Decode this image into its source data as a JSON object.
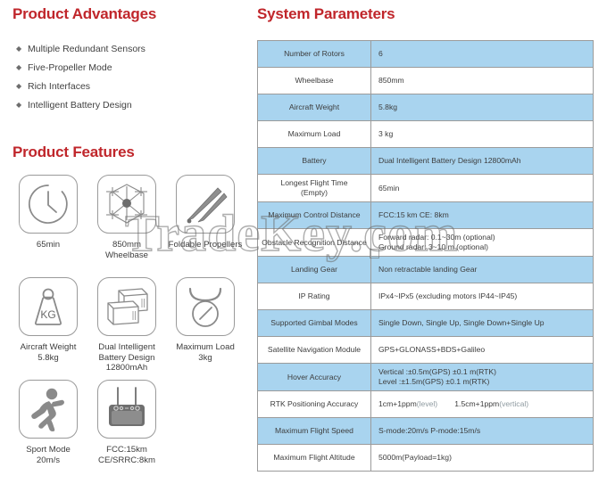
{
  "advantages": {
    "heading": "Product Advantages",
    "bullet_glyph": "◆",
    "items": [
      "Multiple Redundant Sensors",
      "Five-Propeller Mode",
      "Rich Interfaces",
      "Intelligent Battery Design"
    ]
  },
  "features": {
    "heading": "Product Features",
    "items": [
      {
        "icon": "clock-icon",
        "label": "65min"
      },
      {
        "icon": "drone-topview-icon",
        "label": "850mm\nWheelbase"
      },
      {
        "icon": "foldable-propeller-icon",
        "label": "Foldable Propellers"
      },
      {
        "icon": "weight-kg-icon",
        "label": "Aircraft Weight\n5.8kg"
      },
      {
        "icon": "battery-pack-icon",
        "label": "Dual Intelligent\nBattery Design\n12800mAh"
      },
      {
        "icon": "payload-hook-icon",
        "label": "Maximum Load\n3kg"
      },
      {
        "icon": "running-man-icon",
        "label": "Sport Mode\n20m/s"
      },
      {
        "icon": "remote-controller-icon",
        "label": "FCC:15km\nCE/SRRC:8km"
      }
    ]
  },
  "parameters": {
    "heading": "System Parameters",
    "rows": [
      {
        "key": "Number of Rotors",
        "value": "6",
        "shaded": true
      },
      {
        "key": "Wheelbase",
        "value": "850mm",
        "shaded": false
      },
      {
        "key": "Aircraft Weight",
        "value": "5.8kg",
        "shaded": true
      },
      {
        "key": "Maximum Load",
        "value": "3 kg",
        "shaded": false
      },
      {
        "key": "Battery",
        "value": "Dual Intelligent Battery Design 12800mAh",
        "shaded": true
      },
      {
        "key": "Longest Flight Time\n(Empty)",
        "value": "65min",
        "shaded": false
      },
      {
        "key": "Maximum Control Distance",
        "value": "FCC:15 km CE: 8km",
        "shaded": true
      },
      {
        "key": "Obstacle Recognition Distance",
        "value": "Forward radar: 0.1~30m (optional)\nGround radar: 3~10 m (optional)",
        "shaded": false
      },
      {
        "key": "Landing Gear",
        "value": "Non retractable landing Gear",
        "shaded": true
      },
      {
        "key": "IP Rating",
        "value": "IPx4~IPx5 (excluding motors IP44~IP45)",
        "shaded": false
      },
      {
        "key": "Supported Gimbal Modes",
        "value": "Single Down, Single Up, Single Down+Single Up",
        "shaded": true
      },
      {
        "key": "Satellite Navigation Module",
        "value": "GPS+GLONASS+BDS+Galileo",
        "shaded": false
      },
      {
        "key": "Hover Accuracy",
        "value": "Vertical :±0.5m(GPS)   ±0.1 m(RTK)\nLevel     :±1.5m(GPS)   ±0.1 m(RTK)",
        "shaded": true
      },
      {
        "key": "RTK Positioning Accuracy",
        "value": "1cm+1ppm(level)        1.5cm+1ppm(vertical)",
        "shaded": false,
        "value_parts": [
          {
            "text": "1cm+1ppm",
            "muted": false
          },
          {
            "text": "(level)",
            "muted": true
          },
          {
            "text": "        ",
            "muted": false
          },
          {
            "text": "1.5cm+1ppm",
            "muted": false
          },
          {
            "text": "(vertical)",
            "muted": true
          }
        ]
      },
      {
        "key": "Maximum Flight Speed",
        "value": "S-mode:20m/s    P-mode:15m/s",
        "shaded": true
      },
      {
        "key": "Maximum Flight Altitude",
        "value": "5000m(Payload=1kg)",
        "shaded": false
      }
    ]
  },
  "watermark": {
    "text": "TradeKey.com"
  },
  "colors": {
    "heading_red": "#c0262b",
    "table_shade_blue": "#a9d4ef",
    "table_border_gray": "#9b9b9b",
    "icon_gray": "#8a8a8a",
    "body_text": "#3d3d3d"
  }
}
